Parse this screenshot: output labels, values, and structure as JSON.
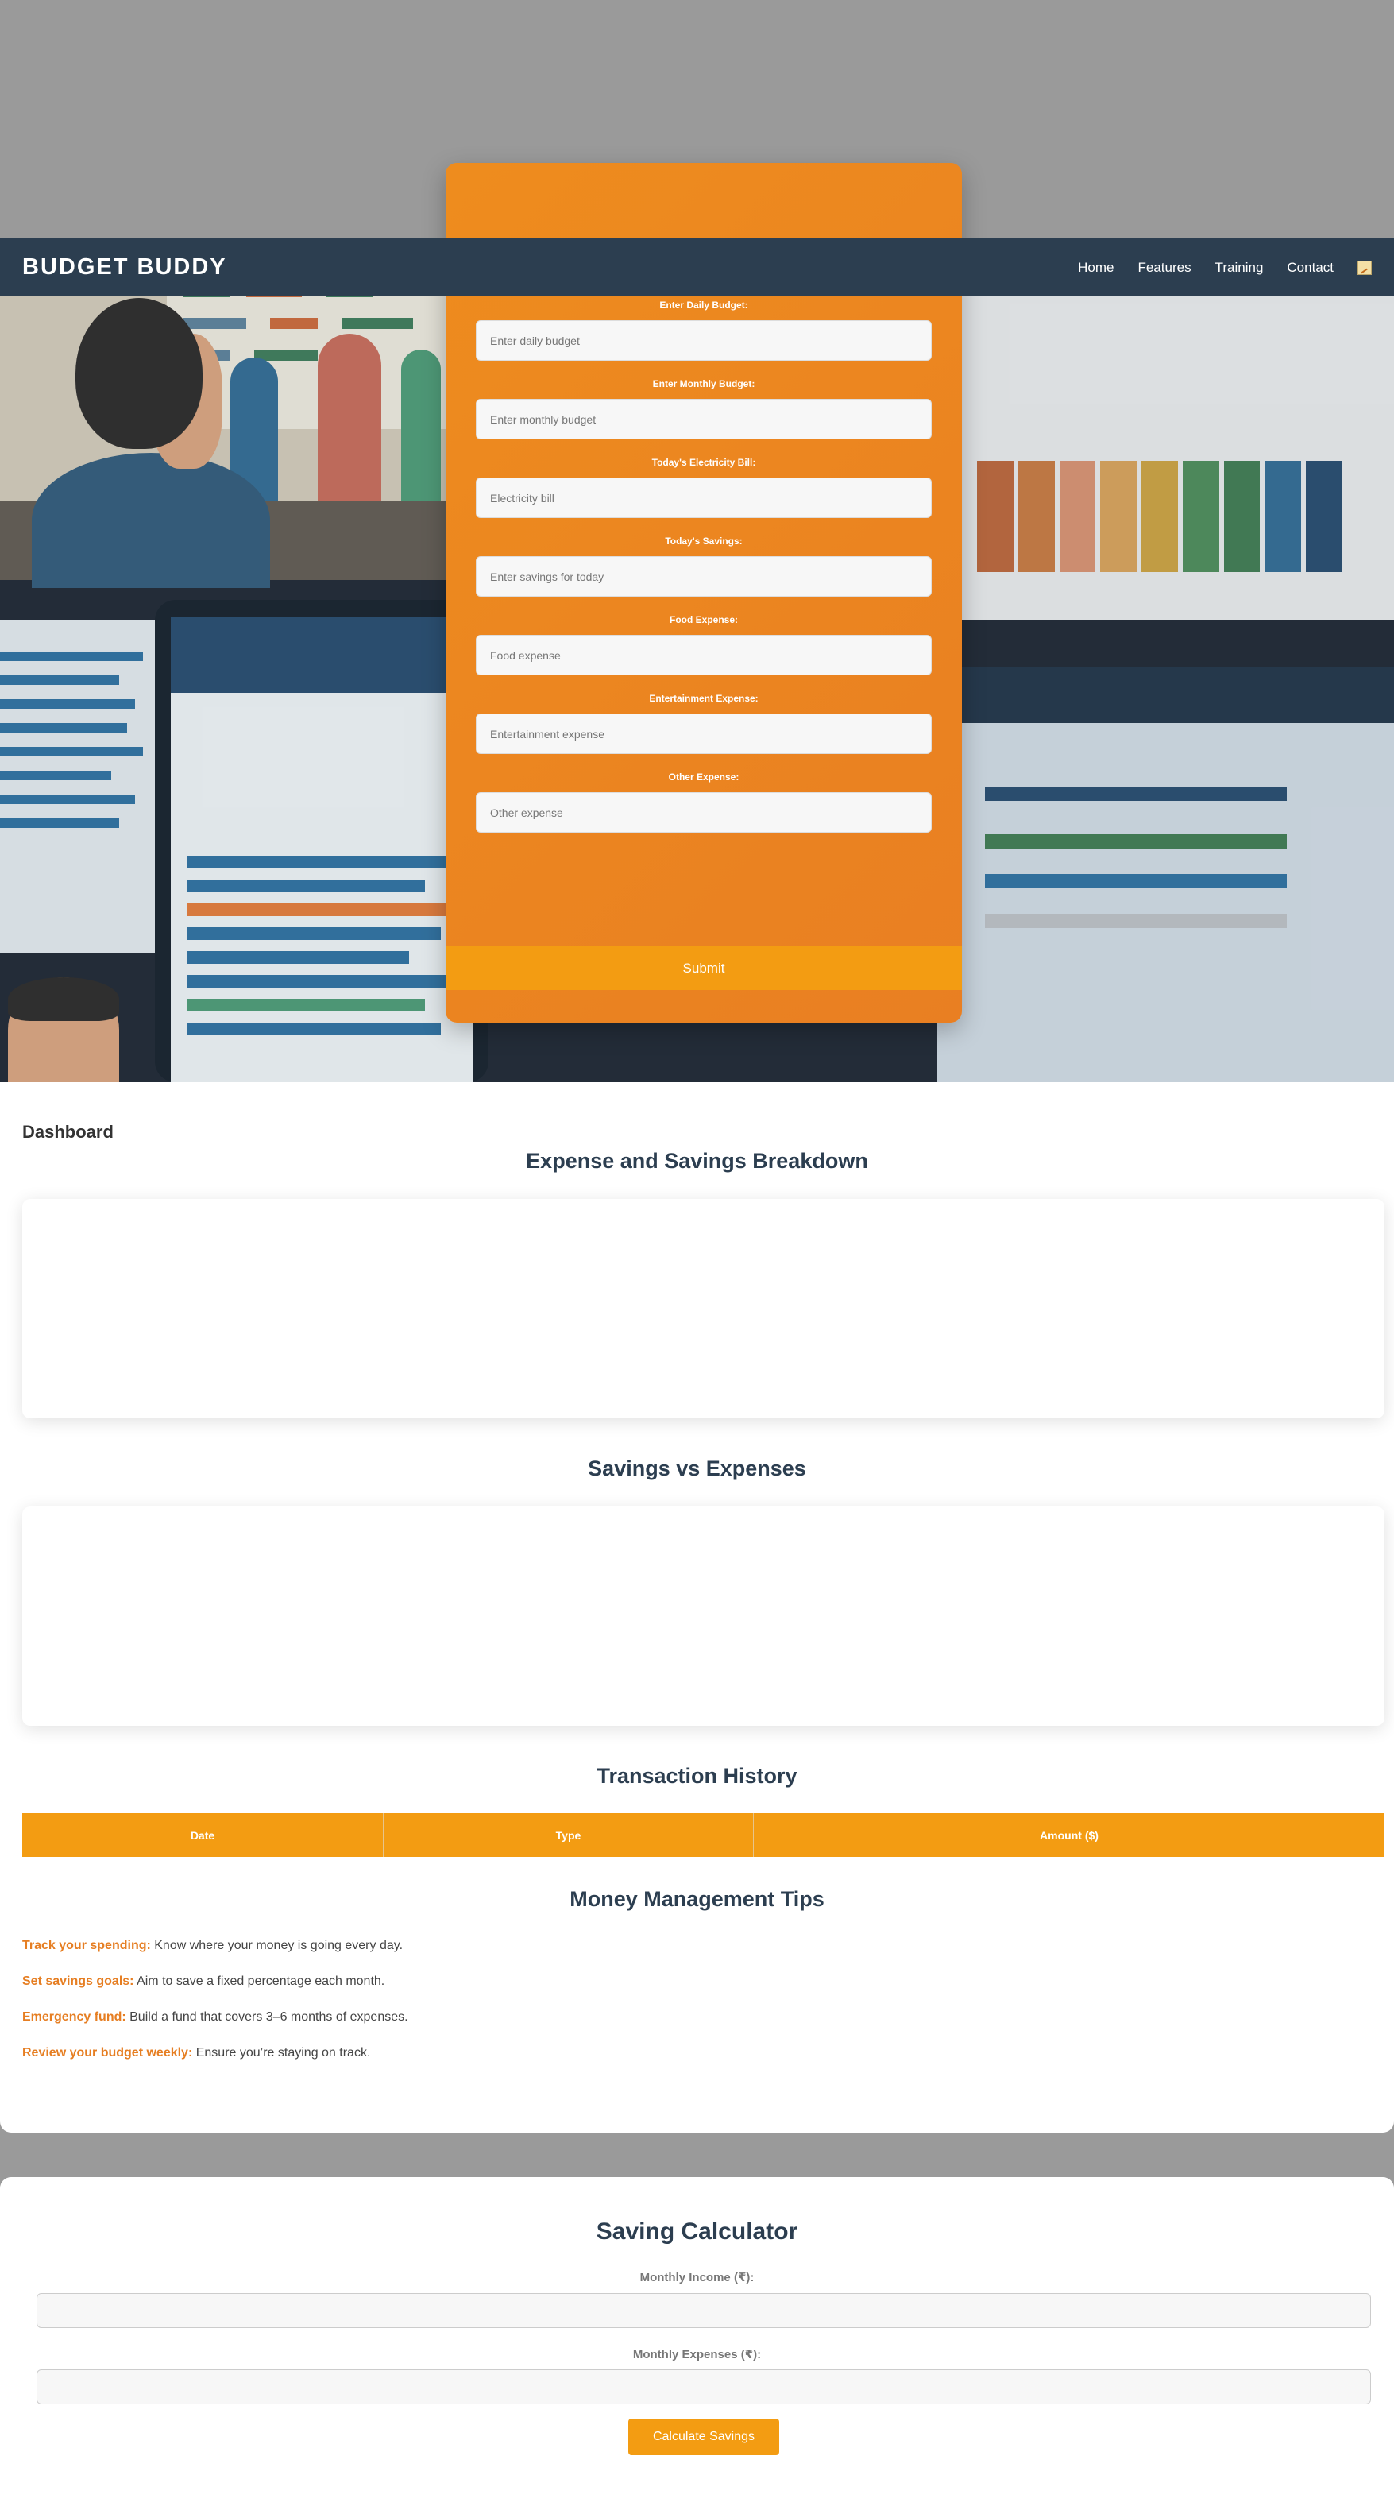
{
  "navbar": {
    "brand": "BUDGET BUDDY",
    "links": [
      "Home",
      "Features",
      "Training",
      "Contact"
    ],
    "icon": "chart-icon"
  },
  "budget_form": {
    "fields": [
      {
        "label": "Enter Daily Budget:",
        "placeholder": "Enter daily budget"
      },
      {
        "label": "Enter Monthly Budget:",
        "placeholder": "Enter monthly budget"
      },
      {
        "label": "Today's Electricity Bill:",
        "placeholder": "Electricity bill"
      },
      {
        "label": "Today's Savings:",
        "placeholder": "Enter savings for today"
      },
      {
        "label": "Food Expense:",
        "placeholder": "Food expense"
      },
      {
        "label": "Entertainment Expense:",
        "placeholder": "Entertainment expense"
      },
      {
        "label": "Other Expense:",
        "placeholder": "Other expense"
      }
    ],
    "submit_label": "Submit"
  },
  "dashboard": {
    "title": "Dashboard",
    "breakdown_heading": "Expense and Savings Breakdown",
    "comparison_heading": "Savings vs Expenses",
    "history_heading": "Transaction History",
    "table_headers": [
      "Date",
      "Type",
      "Amount ($)"
    ],
    "tips_heading": "Money Management Tips",
    "tips": [
      {
        "title": "Track your spending:",
        "text": " Know where your money is going every day."
      },
      {
        "title": "Set savings goals:",
        "text": " Aim to save a fixed percentage each month."
      },
      {
        "title": "Emergency fund:",
        "text": " Build a fund that covers 3–6 months of expenses."
      },
      {
        "title": "Review your budget weekly:",
        "text": " Ensure you’re staying on track."
      }
    ]
  },
  "calculator": {
    "heading": "Saving Calculator",
    "income_label": "Monthly Income (₹):",
    "expenses_label": "Monthly Expenses (₹):",
    "button_label": "Calculate Savings"
  },
  "colors": {
    "navbar": "#2c3e50",
    "accent": "#f39c12",
    "form_card": "#ee8c1e",
    "tip_highlight": "#e67e22"
  }
}
